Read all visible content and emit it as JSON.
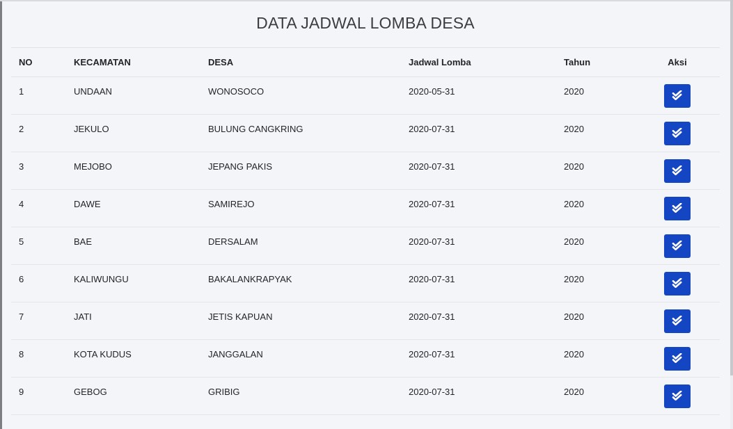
{
  "page": {
    "title": "DATA JADWAL LOMBA DESA"
  },
  "table": {
    "headers": {
      "no": "NO",
      "kecamatan": "KECAMATAN",
      "desa": "DESA",
      "jadwal": "Jadwal Lomba",
      "tahun": "Tahun",
      "aksi": "Aksi"
    },
    "rows": [
      {
        "no": "1",
        "kecamatan": "UNDAAN",
        "desa": "WONOSOCO",
        "jadwal": "2020-05-31",
        "tahun": "2020"
      },
      {
        "no": "2",
        "kecamatan": "JEKULO",
        "desa": "BULUNG CANGKRING",
        "jadwal": "2020-07-31",
        "tahun": "2020"
      },
      {
        "no": "3",
        "kecamatan": "MEJOBO",
        "desa": "JEPANG PAKIS",
        "jadwal": "2020-07-31",
        "tahun": "2020"
      },
      {
        "no": "4",
        "kecamatan": "DAWE",
        "desa": "SAMIREJO",
        "jadwal": "2020-07-31",
        "tahun": "2020"
      },
      {
        "no": "5",
        "kecamatan": "BAE",
        "desa": "DERSALAM",
        "jadwal": "2020-07-31",
        "tahun": "2020"
      },
      {
        "no": "6",
        "kecamatan": "KALIWUNGU",
        "desa": "BAKALANKRAPYAK",
        "jadwal": "2020-07-31",
        "tahun": "2020"
      },
      {
        "no": "7",
        "kecamatan": "JATI",
        "desa": "JETIS KAPUAN",
        "jadwal": "2020-07-31",
        "tahun": "2020"
      },
      {
        "no": "8",
        "kecamatan": "KOTA KUDUS",
        "desa": "JANGGALAN",
        "jadwal": "2020-07-31",
        "tahun": "2020"
      },
      {
        "no": "9",
        "kecamatan": "GEBOG",
        "desa": "GRIBIG",
        "jadwal": "2020-07-31",
        "tahun": "2020"
      }
    ],
    "action_icon": "double-check-icon"
  },
  "colors": {
    "background": "#f4f5f9",
    "action_button": "#1446c3",
    "text": "#212529",
    "divider": "#dfe2e6"
  }
}
